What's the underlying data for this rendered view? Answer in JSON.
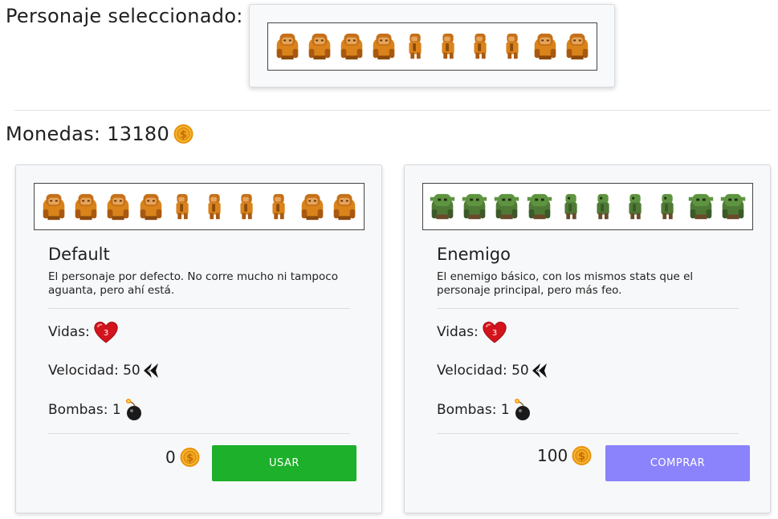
{
  "selected": {
    "label": "Personaje seleccionado:",
    "sprite_color": "orange"
  },
  "coins": {
    "label": "Monedas: 13180"
  },
  "cards": [
    {
      "title": "Default",
      "description": "El personaje por defecto. No corre mucho ni tampoco aguanta, pero ahí está.",
      "sprite_color": "orange",
      "lives_label": "Vidas:",
      "lives_value": "3",
      "speed_label": "Velocidad: 50",
      "bombs_label": "Bombas: 1",
      "price": "0",
      "button_label": "USAR",
      "button_color": "#1db02a"
    },
    {
      "title": "Enemigo",
      "description": "El enemigo básico, con los mismos stats que el personaje principal, pero más feo.",
      "sprite_color": "green",
      "lives_label": "Vidas:",
      "lives_value": "3",
      "speed_label": "Velocidad: 50",
      "bombs_label": "Bombas: 1",
      "price": "100",
      "button_label": "COMPRAR",
      "button_color": "#8b83fb"
    }
  ],
  "icons": {
    "coin": "coin-icon",
    "heart": "heart-icon",
    "speed": "speed-icon",
    "bomb": "bomb-icon"
  }
}
